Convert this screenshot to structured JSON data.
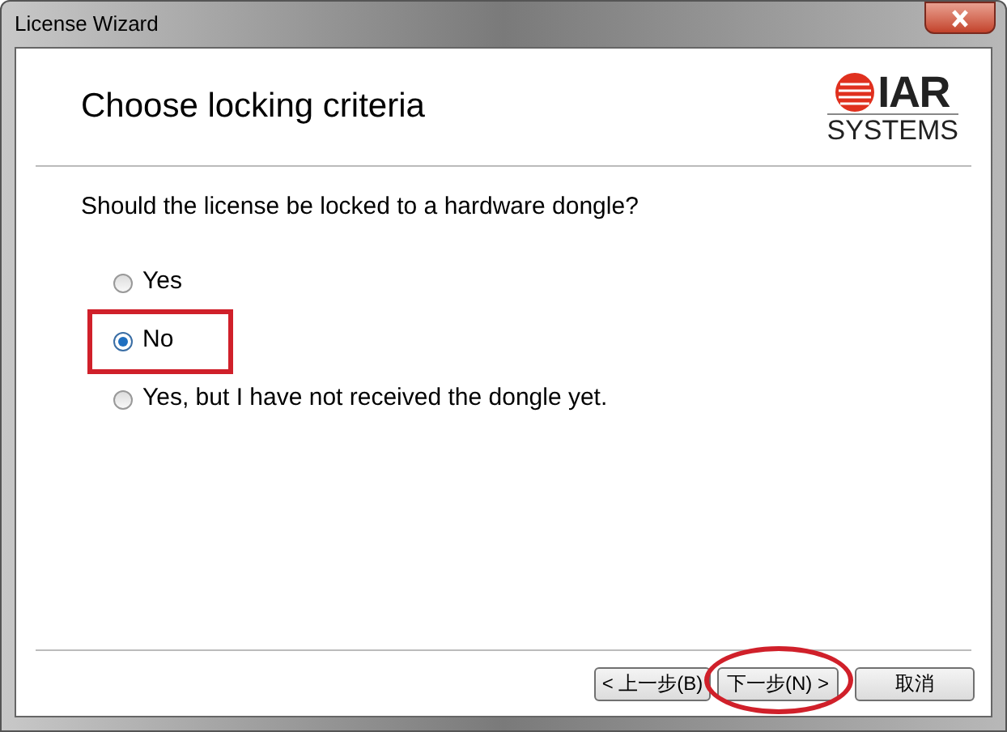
{
  "window": {
    "title": "License Wizard"
  },
  "header": {
    "title": "Choose locking criteria",
    "logo": {
      "line_1": "IAR",
      "line_2": "SYSTEMS"
    }
  },
  "question": "Should the license be locked to a hardware dongle?",
  "options": [
    {
      "label": "Yes",
      "selected": false,
      "highlighted": false
    },
    {
      "label": "No",
      "selected": true,
      "highlighted": true
    },
    {
      "label": "Yes, but I have not received the dongle yet.",
      "selected": false,
      "highlighted": false
    }
  ],
  "buttons": [
    {
      "label": "< 上一步(B)",
      "highlighted": false
    },
    {
      "label": "下一步(N) >",
      "highlighted": true
    },
    {
      "label": "取消",
      "highlighted": false
    }
  ]
}
